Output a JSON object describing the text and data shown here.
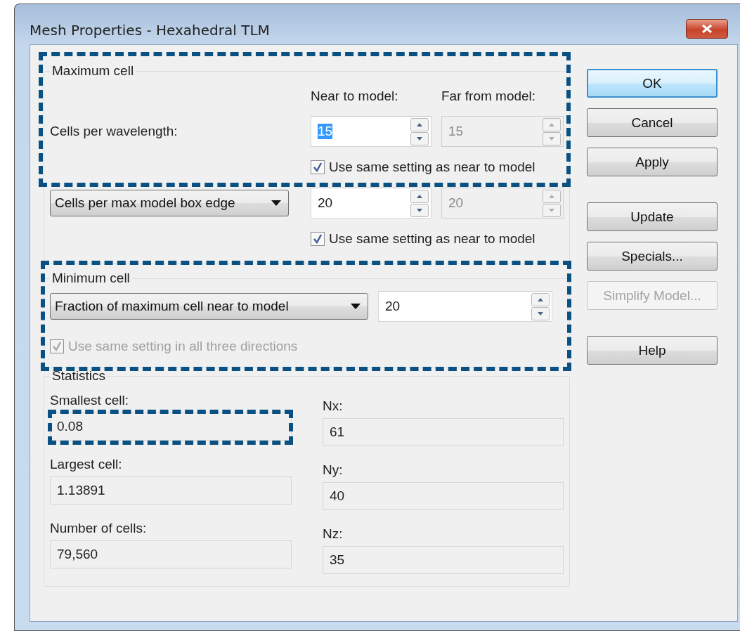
{
  "window": {
    "title": "Mesh Properties - Hexahedral TLM"
  },
  "maximum_cell": {
    "title": "Maximum cell",
    "highlighted": true,
    "column_headers": [
      "Near to model:",
      "Far from model:"
    ],
    "rows": [
      {
        "kind": "label",
        "label": "Cells per wavelength:",
        "near": {
          "value": "15",
          "text_selected": true,
          "disabled": false
        },
        "far": {
          "value": "15",
          "disabled": true
        },
        "same_setting": {
          "label": "Use same setting as near to model",
          "checked": true,
          "disabled": false
        }
      },
      {
        "kind": "dropdown",
        "label": "Cells per max model box edge",
        "near": {
          "value": "20",
          "text_selected": false,
          "disabled": false
        },
        "far": {
          "value": "20",
          "disabled": true
        },
        "same_setting": {
          "label": "Use same setting as near to model",
          "checked": true,
          "disabled": false
        }
      }
    ]
  },
  "minimum_cell": {
    "title": "Minimum cell",
    "highlighted": true,
    "dropdown": "Fraction of maximum cell near to model",
    "field": {
      "value": "20",
      "disabled": false
    },
    "same_setting": {
      "label": "Use same setting in all three directions",
      "checked": true,
      "disabled": true
    }
  },
  "statistics": {
    "title": "Statistics",
    "rows": [
      [
        {
          "label": "Smallest cell:",
          "value": "0.08",
          "highlighted": true
        },
        {
          "label": "Nx:",
          "value": "61",
          "highlighted": false
        }
      ],
      [
        {
          "label": "Largest cell:",
          "value": "1.13891",
          "highlighted": false
        },
        {
          "label": "Ny:",
          "value": "40",
          "highlighted": false
        }
      ],
      [
        {
          "label": "Number of cells:",
          "value": "79,560",
          "highlighted": false
        },
        {
          "label": "Nz:",
          "value": "35",
          "highlighted": false
        }
      ]
    ]
  },
  "button_groups": [
    [
      {
        "label": "OK",
        "default": true,
        "disabled": false
      },
      {
        "label": "Cancel",
        "default": false,
        "disabled": false
      },
      {
        "label": "Apply",
        "default": false,
        "disabled": false
      }
    ],
    [
      {
        "label": "Update",
        "default": false,
        "disabled": false
      },
      {
        "label": "Specials...",
        "default": false,
        "disabled": false
      },
      {
        "label": "Simplify Model...",
        "default": false,
        "disabled": true
      }
    ],
    [
      {
        "label": "Help",
        "default": false,
        "disabled": false
      }
    ]
  ]
}
